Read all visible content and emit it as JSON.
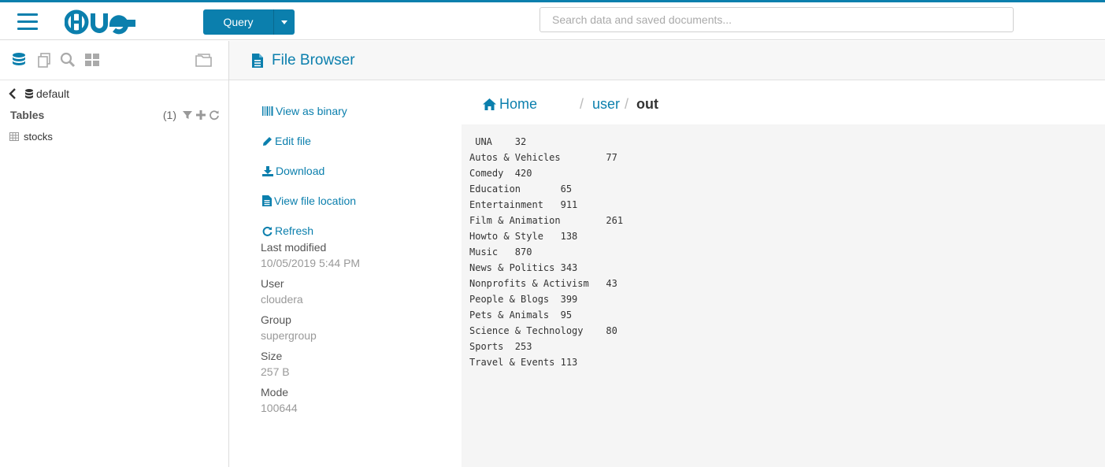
{
  "topbar": {
    "query_label": "Query",
    "search_placeholder": "Search data and saved documents...",
    "brand_color": "#0B7FAD"
  },
  "sidebar": {
    "database": "default",
    "tables_title": "Tables",
    "tables_count": "(1)",
    "tables": [
      "stocks"
    ]
  },
  "main": {
    "title": "File Browser",
    "actions": {
      "view_binary": "View as binary",
      "edit_file": "Edit file",
      "download": "Download",
      "view_location": "View file location",
      "refresh": "Refresh"
    },
    "meta": {
      "last_modified_label": "Last modified",
      "last_modified": "10/05/2019 5:44 PM",
      "user_label": "User",
      "user": "cloudera",
      "group_label": "Group",
      "group": "supergroup",
      "size_label": "Size",
      "size": "257 B",
      "mode_label": "Mode",
      "mode": "100644"
    },
    "breadcrumb": {
      "home": "Home",
      "sep": "/",
      "user": "user",
      "current": "out"
    },
    "file_lines": [
      " UNA\t32",
      "Autos & Vehicles\t77",
      "Comedy\t420",
      "Education\t65",
      "Entertainment\t911",
      "Film & Animation\t261",
      "Howto & Style\t138",
      "Music\t870",
      "News & Politics\t343",
      "Nonprofits & Activism\t43",
      "People & Blogs\t399",
      "Pets & Animals\t95",
      "Science & Technology\t80",
      "Sports\t253",
      "Travel & Events\t113"
    ]
  }
}
